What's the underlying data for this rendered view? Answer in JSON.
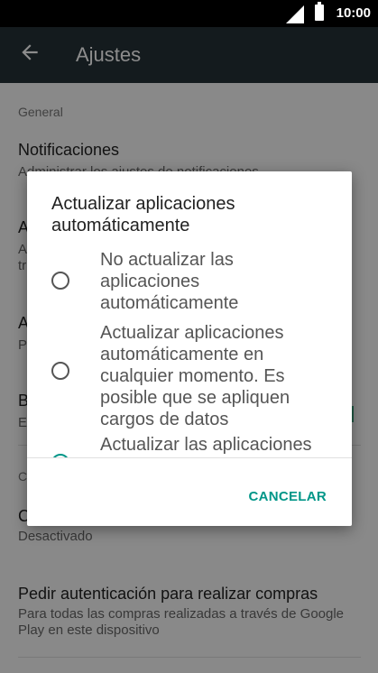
{
  "status_bar": {
    "time": "10:00"
  },
  "app_bar": {
    "title": "Ajustes"
  },
  "settings": {
    "general_header": "General",
    "notifications": {
      "title": "Notificaciones",
      "subtitle": "Administrar los ajustes de notificaciones"
    },
    "partial_a1": {
      "title": "A",
      "subtitle_1": "A",
      "subtitle_2": "tr"
    },
    "partial_a2": {
      "title": "A",
      "subtitle": "P"
    },
    "partial_b": {
      "title": "B",
      "subtitle": "E"
    },
    "partial_c_header": "C",
    "partial_c": {
      "title": "C",
      "subtitle": "Desactivado"
    },
    "purchase_auth": {
      "title": "Pedir autenticación para realizar compras",
      "subtitle": "Para todas las compras realizadas a través de Google Play en este dispositivo"
    }
  },
  "dialog": {
    "title": "Actualizar aplicaciones automáticamente",
    "options": [
      {
        "label": "No actualizar las aplicaciones automáticamente",
        "selected": false
      },
      {
        "label": "Actualizar aplicaciones automáticamente en cualquier momento. Es posible que se apliquen cargos de datos",
        "selected": false
      },
      {
        "label": "Actualizar las aplicaciones",
        "selected": true
      }
    ],
    "cancel_label": "CANCELAR"
  },
  "colors": {
    "accent": "#009688",
    "app_bar": "#263238"
  }
}
